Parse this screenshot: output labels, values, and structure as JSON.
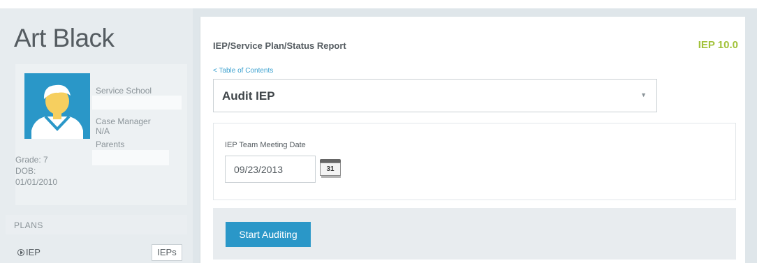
{
  "student": {
    "name": "Art Black",
    "service_school_label": "Service School",
    "case_manager_label": "Case Manager",
    "case_manager_value": "N/A",
    "parents_label": "Parents",
    "grade": "Grade: 7",
    "dob_label": "DOB:",
    "dob_value": "01/01/2010",
    "avatar_icon": "user-avatar-icon"
  },
  "sidebar": {
    "plans_label": "PLANS",
    "iep_link": "IEP",
    "ieps_button": "IEPs"
  },
  "main": {
    "report_title": "IEP/Service Plan/Status Report",
    "version": "IEP 10.0",
    "toc_link": "< Table of Contents",
    "section_select": {
      "selected": "Audit IEP"
    },
    "meeting_date_label": "IEP Team Meeting Date",
    "meeting_date_value": "09/23/2013",
    "calendar_day": "31",
    "start_button": "Start Auditing"
  },
  "colors": {
    "accent": "#2a97c8",
    "version_green": "#a2c23a",
    "background": "#dfe6ea"
  }
}
